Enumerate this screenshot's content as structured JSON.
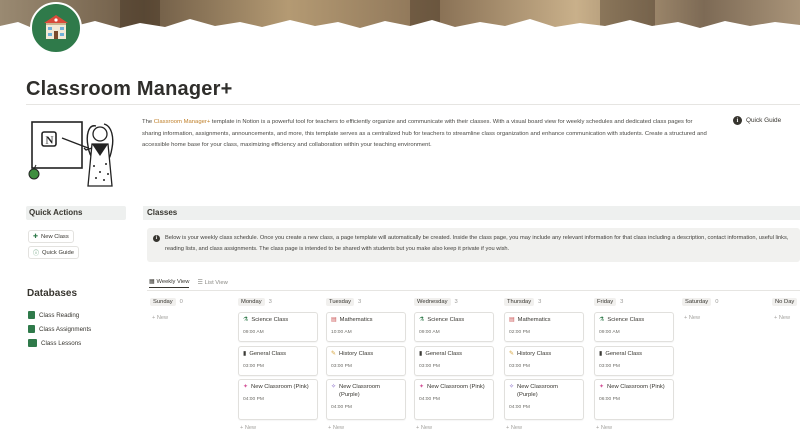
{
  "page": {
    "title": "Classroom Manager+",
    "description_pre": "The ",
    "description_highlight": "Classroom Manager+",
    "description_post": " template in Notion is a powerful tool for teachers to efficiently organize and communicate with their classes. With a visual board view for weekly schedules and dedicated class pages for sharing information, assignments, announcements, and more, this template serves as a centralized hub for teachers to streamline class organization and enhance communication with students. Create a structured and accessible home base for your class, maximizing efficiency and collaboration within your teaching environment.",
    "quick_guide_label": "Quick Guide"
  },
  "quick_actions": {
    "header": "Quick Actions",
    "buttons": [
      {
        "label": "New Class",
        "icon": "plus-icon"
      },
      {
        "label": "Quick Guide",
        "icon": "info-icon"
      }
    ]
  },
  "databases": {
    "header": "Databases",
    "items": [
      {
        "label": "Class Reading"
      },
      {
        "label": "Class Assignments"
      },
      {
        "label": "Class Lessons"
      }
    ]
  },
  "classes": {
    "header": "Classes",
    "callout": "Below is your weekly class schedule. Once you create a new class, a page template will automatically be created. Inside the class page, you may include any relevant information for that class including a description, contact information, useful links, reading lists, and class assignments. The class page is intended to be shared with students but you make also keep it private if you wish.",
    "tabs": [
      {
        "label": "Weekly View",
        "icon": "calendar-icon"
      },
      {
        "label": "List View",
        "icon": "list-icon"
      }
    ],
    "new_label": "+ New",
    "columns": [
      {
        "day": "Sunday",
        "count": "0",
        "cards": []
      },
      {
        "day": "Monday",
        "count": "3",
        "cards": [
          {
            "title": "Science Class",
            "time": "09:00 AM",
            "icon": "flask-icon"
          },
          {
            "title": "General Class",
            "time": "03:00 PM",
            "icon": "book-icon"
          },
          {
            "title": "New Classroom (Pink)",
            "time": "04:00 PM",
            "icon": "star-icon"
          }
        ]
      },
      {
        "day": "Tuesday",
        "count": "3",
        "cards": [
          {
            "title": "Mathematics",
            "time": "10:00 AM",
            "icon": "calculator-icon"
          },
          {
            "title": "History Class",
            "time": "03:00 PM",
            "icon": "scroll-icon"
          },
          {
            "title": "New Classroom (Purple)",
            "time": "04:00 PM",
            "icon": "sparkle-icon"
          }
        ]
      },
      {
        "day": "Wednesday",
        "count": "3",
        "cards": [
          {
            "title": "Science Class",
            "time": "09:00 AM",
            "icon": "flask-icon"
          },
          {
            "title": "General Class",
            "time": "03:00 PM",
            "icon": "book-icon"
          },
          {
            "title": "New Classroom (Pink)",
            "time": "04:00 PM",
            "icon": "star-icon"
          }
        ]
      },
      {
        "day": "Thursday",
        "count": "3",
        "cards": [
          {
            "title": "Mathematics",
            "time": "02:00 PM",
            "icon": "calculator-icon"
          },
          {
            "title": "History Class",
            "time": "03:00 PM",
            "icon": "scroll-icon"
          },
          {
            "title": "New Classroom (Purple)",
            "time": "04:00 PM",
            "icon": "sparkle-icon"
          }
        ]
      },
      {
        "day": "Friday",
        "count": "3",
        "cards": [
          {
            "title": "Science Class",
            "time": "09:00 AM",
            "icon": "flask-icon"
          },
          {
            "title": "General Class",
            "time": "03:00 PM",
            "icon": "book-icon"
          },
          {
            "title": "New Classroom (Pink)",
            "time": "06:00 PM",
            "icon": "star-icon"
          }
        ]
      },
      {
        "day": "Saturday",
        "count": "0",
        "cards": []
      },
      {
        "day": "No Day",
        "count": "",
        "cards": []
      }
    ]
  }
}
